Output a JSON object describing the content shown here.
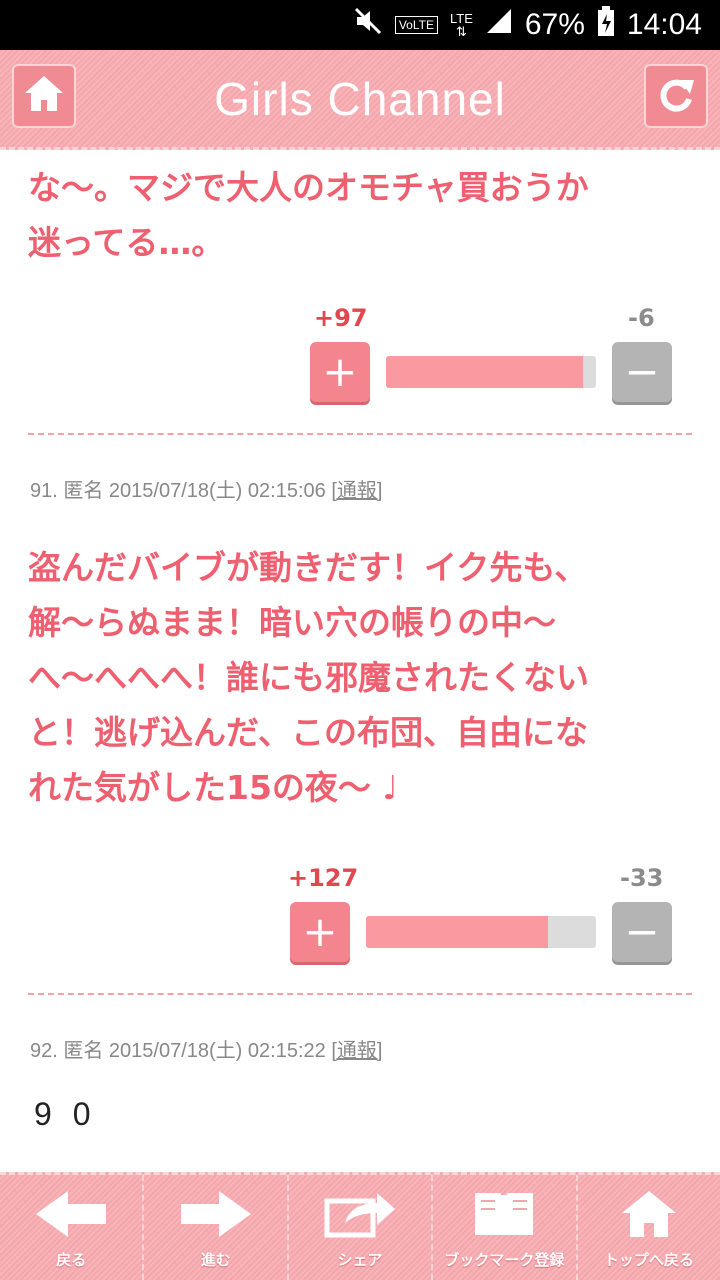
{
  "status_bar": {
    "volte": "VoLTE",
    "lte": "LTE",
    "battery": "67%",
    "time": "14:04"
  },
  "header": {
    "title": "Girls Channel"
  },
  "comments": [
    {
      "text_lines": [
        "な〜。マジで大人のオモチャ買おうか",
        "迷ってる…。"
      ],
      "plus": "+97",
      "minus": "-6",
      "ratio": 0.94
    },
    {
      "meta": "91. 匿名 2015/07/18(土) 02:15:06",
      "report": "[通報]",
      "text_lines": [
        "盗んだバイブが動きだす！イク先も、",
        "解〜らぬまま！暗い穴の帳りの中〜",
        "へ〜へへへ！誰にも邪魔されたくない",
        "と！逃げ込んだ、この布団、自由にな",
        "れた気がした15の夜〜 ♩"
      ],
      "plus": "+127",
      "minus": "-33",
      "ratio": 0.79
    },
    {
      "meta": "92. 匿名 2015/07/18(土) 02:15:22",
      "report": "[通報]",
      "text": "9 0"
    }
  ],
  "footer": {
    "back": "戻る",
    "forward": "進む",
    "share": "シェア",
    "bookmark": "ブックマーク登録",
    "top": "トップへ戻る"
  },
  "colors": {
    "accent": "#f08a93",
    "comment_text": "#ee5f6f",
    "plus_count": "#e0474f"
  }
}
